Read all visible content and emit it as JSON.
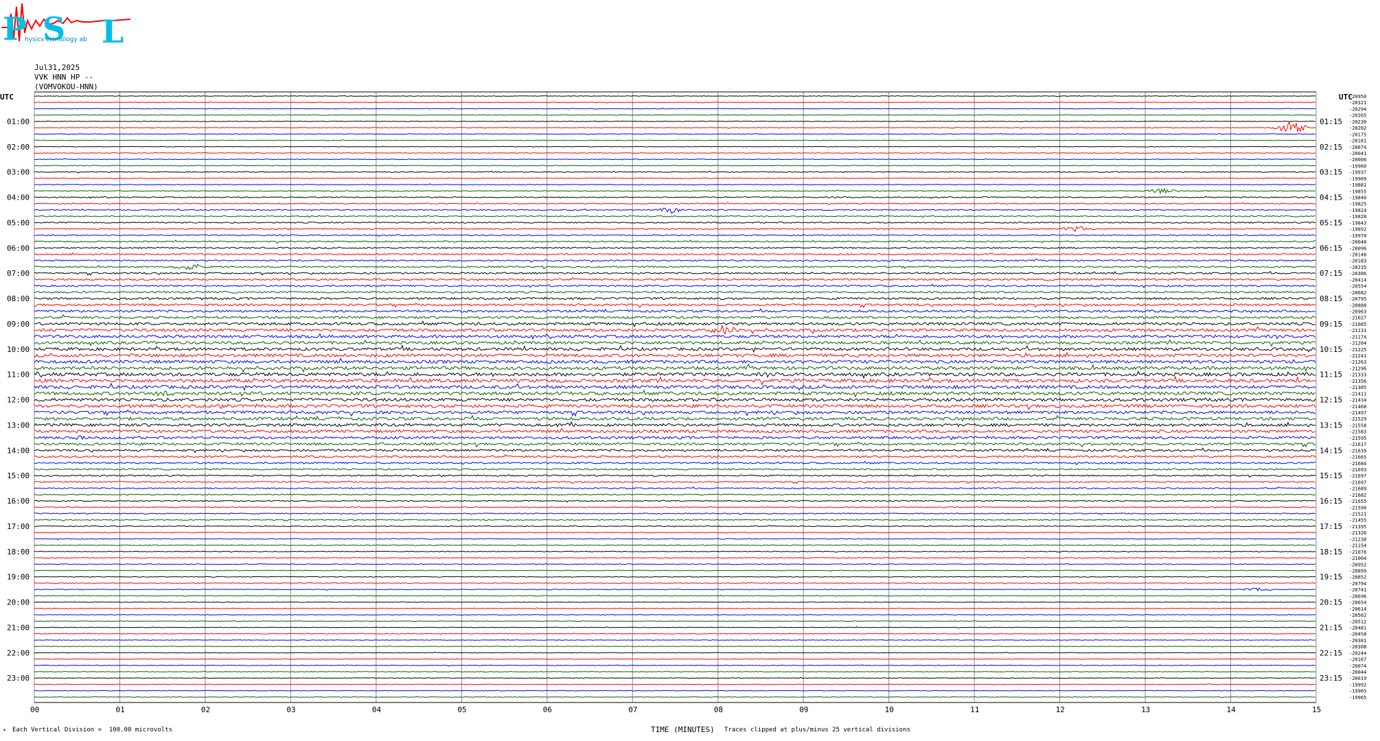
{
  "header": {
    "logo_text": "PSL",
    "logo_subtext": "Physics Seismology Lab",
    "date": "Jul31,2025",
    "channel": "VVK HNN HP --",
    "station": "(VOMVOKOU-HNN)"
  },
  "footer": {
    "scale_note": "Each Vertical Division =  100.00 microvolts",
    "xlabel": "TIME (MINUTES)",
    "clip_note": "Traces clipped at plus/minus 25 vertical divisions",
    "corner_mark": "*"
  },
  "colors": [
    "#000000",
    "#ff0000",
    "#0000ff",
    "#006400"
  ],
  "chart_data": {
    "type": "line",
    "title": "Jul31,2025 VVK HNN HP -- (VOMVOKOU-HNN)",
    "xlabel": "TIME (MINUTES)",
    "ylabel": "UTC",
    "xlim": [
      0,
      15
    ],
    "x_ticks": [
      "00",
      "01",
      "02",
      "03",
      "04",
      "05",
      "06",
      "07",
      "08",
      "09",
      "10",
      "11",
      "12",
      "13",
      "14",
      "15"
    ],
    "left_axis_label": "UTC",
    "right_axis_label": "UTC",
    "left_labels": [
      "01:00",
      "02:00",
      "03:00",
      "04:00",
      "05:00",
      "06:00",
      "07:00",
      "08:00",
      "09:00",
      "10:00",
      "11:00",
      "12:00",
      "13:00",
      "14:00",
      "15:00",
      "16:00",
      "17:00",
      "18:00",
      "19:00",
      "20:00",
      "21:00",
      "22:00",
      "23:00"
    ],
    "right_labels": [
      "01:15",
      "02:15",
      "03:15",
      "04:15",
      "05:15",
      "06:15",
      "07:15",
      "08:15",
      "09:15",
      "10:15",
      "11:15",
      "12:15",
      "13:15",
      "14:15",
      "15:15",
      "16:15",
      "17:15",
      "18:15",
      "19:15",
      "20:15",
      "21:15",
      "22:15",
      "23:15"
    ],
    "trace_color_cycle": [
      "black",
      "red",
      "blue",
      "green"
    ],
    "trace_interval_minutes": 15,
    "trace_count": 96,
    "trace_offsets": [
      -20950,
      -20321,
      -20294,
      -20265,
      -20230,
      -20202,
      -20175,
      -20181,
      -20074,
      -20041,
      -20006,
      -19960,
      -19937,
      -19909,
      -19881,
      -19855,
      -19840,
      -19825,
      -19824,
      -19828,
      -19843,
      -19892,
      -19970,
      -20040,
      -20096,
      -20148,
      -20183,
      -20235,
      -20306,
      -20414,
      -20554,
      -20682,
      -20795,
      -20888,
      -20963,
      -21027,
      -21085,
      -21131,
      -21174,
      -21204,
      -21225,
      -21241,
      -21263,
      -21296,
      -21333,
      -21356,
      -21385,
      -21411,
      -21434,
      -21468,
      -21497,
      -21529,
      -21558,
      -21583,
      -21595,
      -21617,
      -21639,
      -21665,
      -21684,
      -21693,
      -21697,
      -21697,
      -21689,
      -21682,
      -21655,
      -21590,
      -21521,
      -21455,
      -21395,
      -21326,
      -21238,
      -21154,
      -21076,
      -21004,
      -20952,
      -20899,
      -20852,
      -20794,
      -20741,
      -20696,
      -20654,
      -20614,
      -20562,
      -20512,
      -20481,
      -20458,
      -20381,
      -20308,
      -20244,
      -20167,
      -20074,
      -20044,
      -20019,
      -19992,
      -19965,
      -19965
    ],
    "activity_level": [
      0.4,
      0.4,
      0.4,
      0.4,
      0.4,
      0.4,
      0.4,
      0.4,
      0.4,
      0.45,
      0.45,
      0.5,
      0.6,
      0.5,
      0.5,
      0.6,
      0.8,
      0.7,
      0.7,
      0.8,
      0.9,
      0.8,
      0.8,
      0.9,
      1.0,
      1.0,
      1.0,
      1.1,
      1.2,
      1.2,
      1.2,
      1.3,
      1.5,
      1.5,
      1.6,
      1.7,
      1.9,
      2.0,
      2.0,
      2.0,
      2.1,
      2.2,
      2.2,
      2.3,
      2.4,
      2.4,
      2.3,
      2.3,
      2.2,
      2.2,
      2.1,
      2.1,
      2.0,
      2.0,
      1.8,
      1.7,
      1.5,
      1.3,
      1.2,
      1.1,
      1.0,
      0.9,
      0.9,
      0.8,
      0.8,
      0.7,
      0.7,
      0.7,
      0.6,
      0.6,
      0.6,
      0.6,
      0.5,
      0.5,
      0.5,
      0.5,
      0.5,
      0.5,
      0.45,
      0.45,
      0.45,
      0.45,
      0.45,
      0.4,
      0.4,
      0.4,
      0.4,
      0.4,
      0.4,
      0.4,
      0.4,
      0.4,
      0.4,
      0.4,
      0.4,
      0.4
    ],
    "events": [
      {
        "trace": 5,
        "minute": 14.7,
        "amplitude": 10
      },
      {
        "trace": 37,
        "minute": 8.1,
        "amplitude": 7
      },
      {
        "trace": 18,
        "minute": 7.45,
        "amplitude": 5
      },
      {
        "trace": 15,
        "minute": 13.2,
        "amplitude": 4
      },
      {
        "trace": 21,
        "minute": 12.2,
        "amplitude": 4
      },
      {
        "trace": 27,
        "minute": 1.8,
        "amplitude": 5
      },
      {
        "trace": 47,
        "minute": 1.5,
        "amplitude": 4
      },
      {
        "trace": 52,
        "minute": 6.3,
        "amplitude": 3
      },
      {
        "trace": 54,
        "minute": 0.5,
        "amplitude": 4
      },
      {
        "trace": 78,
        "minute": 14.3,
        "amplitude": 3
      }
    ]
  }
}
